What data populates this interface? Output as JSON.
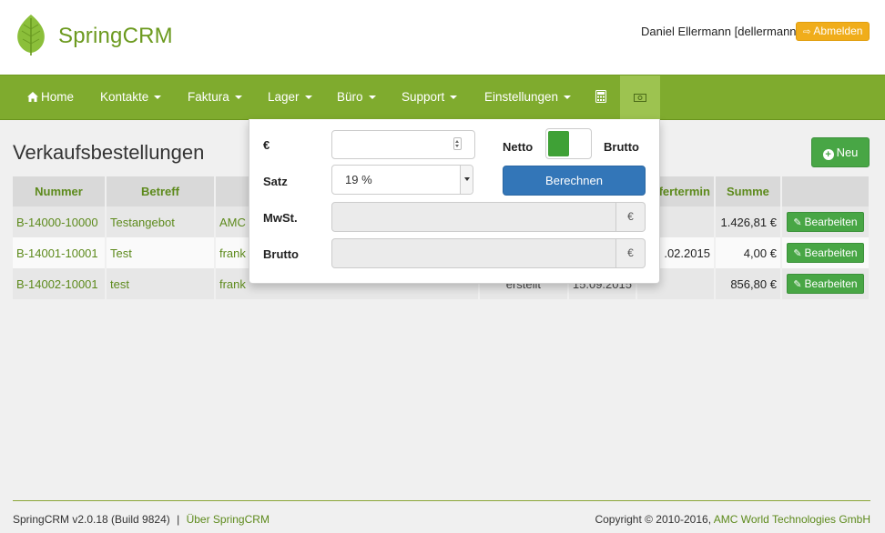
{
  "app": {
    "name": "SpringCRM",
    "user": "Daniel Ellermann [dellermann]",
    "logout_label": "Abmelden"
  },
  "nav": {
    "home": "Home",
    "contacts": "Kontakte",
    "invoicing": "Faktura",
    "stock": "Lager",
    "office": "Büro",
    "support": "Support",
    "settings": "Einstellungen"
  },
  "page": {
    "title": "Verkaufsbestellungen",
    "new_label": "Neu"
  },
  "table": {
    "headers": {
      "number": "Nummer",
      "subject": "Betreff",
      "delivery": "Liefertermin",
      "total": "Summe"
    },
    "rows": [
      {
        "number": "B-14000-10000",
        "subject": "Testangebot",
        "org": "AMC",
        "status": "",
        "date": "",
        "delivery": "",
        "total": "1.426,81 €",
        "edit": "Bearbeiten"
      },
      {
        "number": "B-14001-10001",
        "subject": "Test",
        "org": "frank",
        "status": "",
        "date": "",
        "delivery": ".02.2015",
        "total": "4,00 €",
        "edit": "Bearbeiten"
      },
      {
        "number": "B-14002-10001",
        "subject": "test",
        "org": "frank",
        "status": "erstellt",
        "date": "15.09.2015",
        "delivery": "",
        "total": "856,80 €",
        "edit": "Bearbeiten"
      }
    ]
  },
  "calculator": {
    "amount_label": "€",
    "amount_value": "",
    "rate_label": "Satz",
    "rate_value": "19 %",
    "netto_label": "Netto",
    "brutto_label": "Brutto",
    "calc_label": "Berechnen",
    "tax_label": "MwSt.",
    "tax_value": "",
    "gross_label": "Brutto",
    "gross_value": "",
    "currency_symbol": "€"
  },
  "footer": {
    "version": "SpringCRM v2.0.18 (Build 9824)",
    "separator": "|",
    "about": "Über SpringCRM",
    "copyright": "Copyright © 2010-2016,",
    "company": "AMC World Technologies GmbH"
  },
  "colors": {
    "nav_green": "#7fab2e",
    "button_green": "#48a645",
    "logout_orange": "#f0ad1b",
    "calc_blue": "#3376b8",
    "link_green": "#5d8a1c"
  }
}
